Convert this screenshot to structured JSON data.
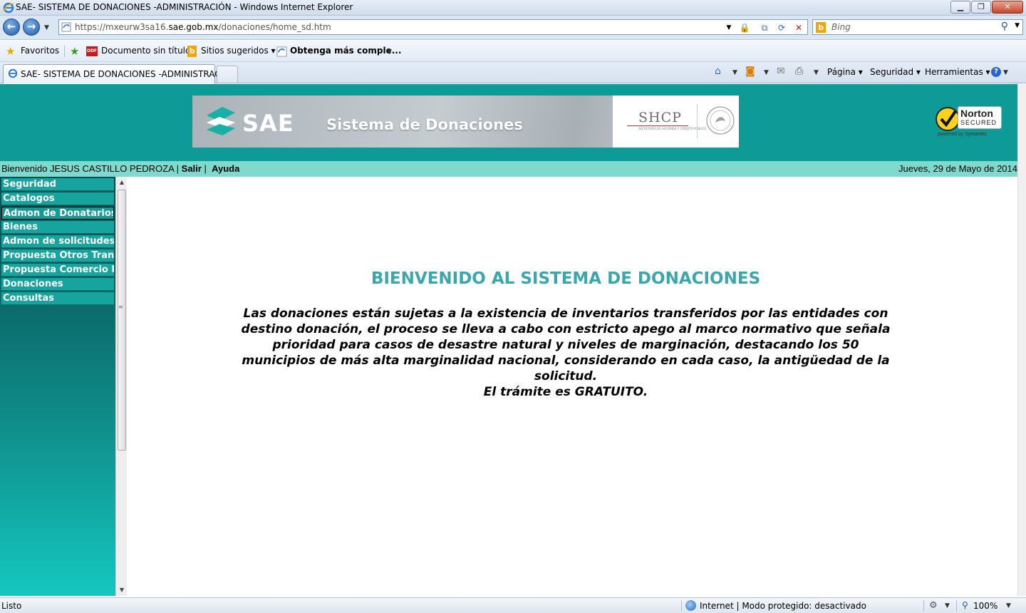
{
  "window": {
    "title": "SAE- SISTEMA DE DONACIONES -ADMINISTRACIÓN - Windows Internet Explorer",
    "min_label": "▁",
    "max_label": "❐",
    "close_label": "✕"
  },
  "addressbar": {
    "url_prefix": "https://mxeurw3sa16.",
    "url_domain": "sae.gob.mx",
    "url_suffix": "/donaciones/home_sd.htm",
    "search_placeholder": "Bing"
  },
  "favorites": {
    "favorites_label": "Favoritos",
    "items": [
      {
        "label": "Documento sin título",
        "icon": "ddf-icon",
        "icon_text": "DDF"
      },
      {
        "label": "Sitios sugeridos ▾",
        "icon": "bing-icon",
        "icon_text": "b"
      },
      {
        "label": "Obtenga más comple...",
        "icon": "ie-icon"
      }
    ]
  },
  "tabs": {
    "active_label": "SAE- SISTEMA DE DONACIONES -ADMINISTRACI..."
  },
  "commandbar": {
    "page_label": "Página ▾",
    "security_label": "Seguridad ▾",
    "tools_label": "Herramientas ▾",
    "help_label": "?"
  },
  "header": {
    "sae_label": "SAE",
    "system_name": "Sistema de Donaciones",
    "shcp_label": "SHCP",
    "shcp_sub": "SECRETARÍA DE HACIENDA Y CRÉDITO PÚBLICO",
    "norton_label": "Norton",
    "norton_secured": "SECURED",
    "norton_powered": "powered by Symantec"
  },
  "welcome": {
    "text": "Bienvenido JESUS CASTILLO PEDROZA |",
    "salir": "Salir",
    "separator": "|",
    "ayuda": "Ayuda",
    "date": "Jueves, 29 de Mayo de 2014"
  },
  "menu": {
    "items": [
      {
        "label": "Seguridad"
      },
      {
        "label": "Catalogos"
      },
      {
        "label": "Admon de Donatarios"
      },
      {
        "label": "Bienes"
      },
      {
        "label": "Admon de solicitudes"
      },
      {
        "label": "Propuesta Otros Transferentes"
      },
      {
        "label": "Propuesta Comercio Exterior"
      },
      {
        "label": "Donaciones"
      },
      {
        "label": "Consultas"
      }
    ]
  },
  "main": {
    "title": "BIENVENIDO AL SISTEMA DE DONACIONES",
    "paragraph": "Las donaciones están sujetas a la existencia de inventarios transferidos por las entidades con destino donación, el proceso se lleva a cabo con estricto apego al marco normativo que señala prioridad para casos de desastre natural y niveles de marginación, destacando los 50 municipios de más alta marginalidad nacional, considerando en cada caso, la antigüedad de la solicitud.",
    "free_note": "El trámite es GRATUITO."
  },
  "status": {
    "text": "Listo",
    "zone": "Internet | Modo protegido: desactivado",
    "zoom": "100%"
  }
}
